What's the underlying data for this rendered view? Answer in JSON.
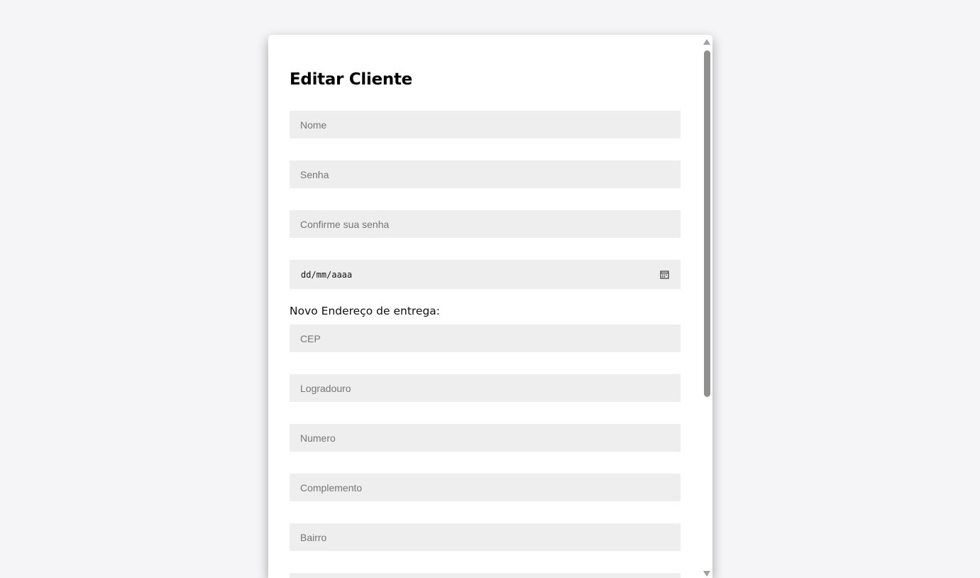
{
  "form": {
    "title": "Editar Cliente",
    "fields": {
      "nome": {
        "placeholder": "Nome",
        "value": ""
      },
      "senha": {
        "placeholder": "Senha",
        "value": ""
      },
      "confirme_senha": {
        "placeholder": "Confirme sua senha",
        "value": ""
      },
      "data": {
        "display": "dd/mm/aaaa",
        "icon": "calendar-icon"
      },
      "cep": {
        "placeholder": "CEP",
        "value": ""
      },
      "logradouro": {
        "placeholder": "Logradouro",
        "value": ""
      },
      "numero": {
        "placeholder": "Numero",
        "value": ""
      },
      "complemento": {
        "placeholder": "Complemento",
        "value": ""
      },
      "bairro": {
        "placeholder": "Bairro",
        "value": ""
      }
    },
    "address_section_label": "Novo Endereço de entrega:"
  }
}
